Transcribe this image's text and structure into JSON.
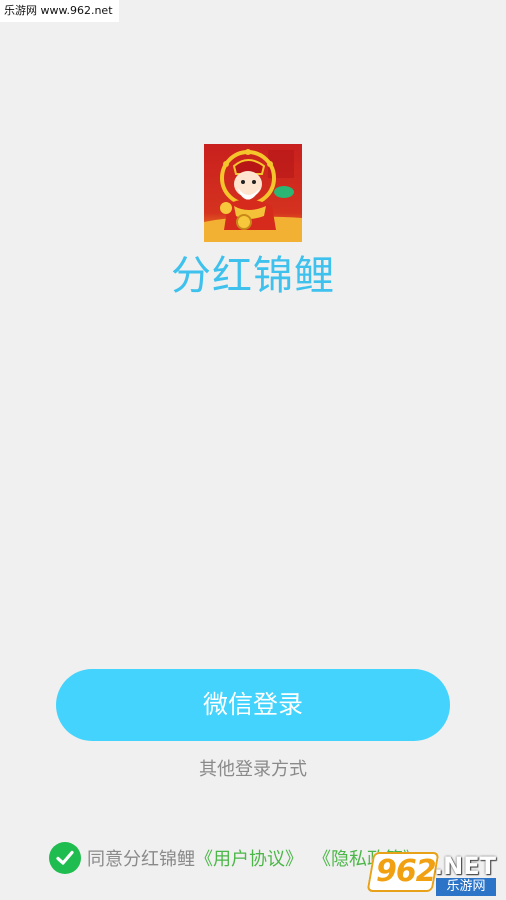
{
  "watermark": {
    "top_label": "乐游网 www.962.net",
    "bottom_number": "962",
    "bottom_suffix": ".NET",
    "bottom_site": "乐游网"
  },
  "app": {
    "name": "分红锦鲤",
    "logo_icon": "god-of-wealth-logo"
  },
  "login": {
    "wechat_button_label": "微信登录",
    "other_methods_label": "其他登录方式"
  },
  "agreement": {
    "checked": true,
    "prefix": "同意分红锦鲤",
    "user_agreement_link": "《用户协议》",
    "privacy_policy_link": "《隐私政策》"
  },
  "colors": {
    "background": "#f0f0f0",
    "app_name": "#3ec1ed",
    "button_bg": "#44d3fc",
    "button_text": "#ffffff",
    "muted_text": "#8a8a8a",
    "link": "#4cb748",
    "check": "#1fbd4f"
  }
}
